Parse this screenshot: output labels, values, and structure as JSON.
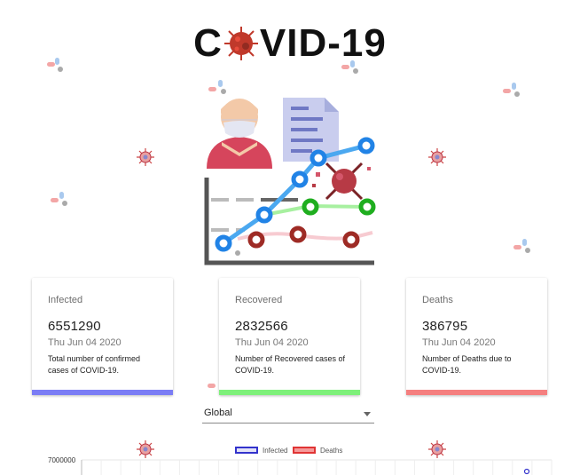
{
  "logo": {
    "prefix": "C",
    "suffix": "VID-19"
  },
  "cards": [
    {
      "title": "Infected",
      "value": "6551290",
      "date": "Thu Jun 04 2020",
      "description": "Total number of confirmed cases of COVID-19.",
      "color": "#7b7df5"
    },
    {
      "title": "Recovered",
      "value": "2832566",
      "date": "Thu Jun 04 2020",
      "description": "Number of Recovered cases of COVID-19.",
      "color": "#7ef07a"
    },
    {
      "title": "Deaths",
      "value": "386795",
      "date": "Thu Jun 04 2020",
      "description": "Number of Deaths due to COVID-19.",
      "color": "#f57f7f"
    }
  ],
  "country_select": {
    "value": "Global"
  },
  "chart_data": {
    "type": "line",
    "series": [
      {
        "name": "Infected",
        "color": "#3333cc"
      },
      {
        "name": "Deaths",
        "color": "#e03434"
      }
    ],
    "y_tick_labels": [
      "7000000"
    ],
    "grid": true,
    "legend_position": "top"
  },
  "icons": {
    "background": [
      "virus-icon",
      "pills-icon"
    ],
    "hero": "covid-statistics-illustration"
  }
}
